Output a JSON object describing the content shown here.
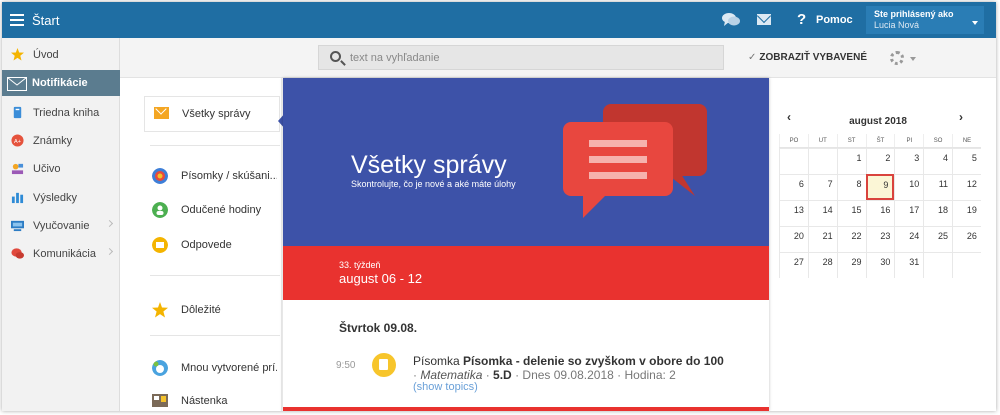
{
  "app": {
    "title": "Štart"
  },
  "header": {
    "help_label": "Pomoc",
    "user_prefix": "Ste prihlásený ako",
    "user_name": "Lucia Nová"
  },
  "sidebar": {
    "items": [
      {
        "label": "Úvod",
        "icon": "star-icon"
      },
      {
        "label": "Notifikácie",
        "icon": "envelope-icon"
      },
      {
        "label": "Triedna kniha",
        "icon": "book-icon"
      },
      {
        "label": "Známky",
        "icon": "grade-icon"
      },
      {
        "label": "Učivo",
        "icon": "teacher-icon"
      },
      {
        "label": "Výsledky",
        "icon": "bar-chart-icon"
      },
      {
        "label": "Vyučovanie",
        "icon": "classroom-icon"
      },
      {
        "label": "Komunikácia",
        "icon": "chat-icon"
      }
    ]
  },
  "toolbar": {
    "search_placeholder": "text na vyhľadanie",
    "show_completed": "ZOBRAZIŤ VYBAVENÉ"
  },
  "msgnav": {
    "items": [
      {
        "label": "Všetky správy"
      },
      {
        "label": "Písomky / skúšani..."
      },
      {
        "label": "Odučené hodiny"
      },
      {
        "label": "Odpovede"
      },
      {
        "label": "Dôležité"
      },
      {
        "label": "Mnou vytvorené prí..."
      },
      {
        "label": "Nástenka"
      }
    ]
  },
  "hero": {
    "title": "Všetky správy",
    "subtitle": "Skontrolujte, čo je nové a aké máte úlohy"
  },
  "week": {
    "label": "33. týždeň",
    "range": "august 06 - 12"
  },
  "feed": {
    "day_heading": "Štvrtok 09.08.",
    "entry": {
      "time": "9:50",
      "type": "Písomka",
      "title": "Písomka - delenie so zvyškom v obore do 100",
      "subject": "Matematika",
      "class": "5.D",
      "date_text": "Dnes 09.08.2018",
      "lesson": "Hodina: 2",
      "show_topics": "(show topics)"
    }
  },
  "calendar": {
    "month": "august 2018",
    "prev": "‹",
    "next": "›",
    "weekdays": [
      "PO",
      "UT",
      "ST",
      "ŠT",
      "PI",
      "SO",
      "NE"
    ],
    "weeks": [
      [
        "",
        "",
        "1",
        "2",
        "3",
        "4",
        "5"
      ],
      [
        "6",
        "7",
        "8",
        "9",
        "10",
        "11",
        "12"
      ],
      [
        "13",
        "14",
        "15",
        "16",
        "17",
        "18",
        "19"
      ],
      [
        "20",
        "21",
        "22",
        "23",
        "24",
        "25",
        "26"
      ],
      [
        "27",
        "28",
        "29",
        "30",
        "31",
        "",
        ""
      ]
    ],
    "today": "9",
    "marker_color": "#d9433d"
  },
  "colors": {
    "topbar": "#1f6ea3",
    "hero": "#3d52a8",
    "week_band": "#e9322f",
    "link": "#6aa0d8"
  }
}
